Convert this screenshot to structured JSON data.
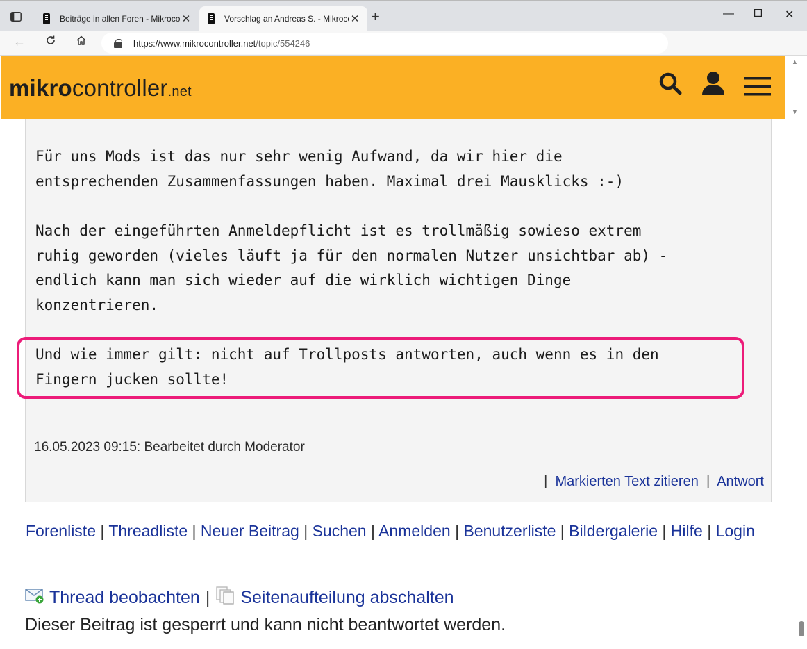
{
  "browser": {
    "tabs": [
      {
        "title": "Beiträge in allen Foren - Mikrocontroller.net"
      },
      {
        "title": "Vorschlag an Andreas S. - Mikrocontroller.net"
      }
    ],
    "url_host": "https://www.mikrocontroller.net",
    "url_path": "/topic/554246"
  },
  "site": {
    "logo_bold": "mikro",
    "logo_regular": "controller",
    "logo_tld": ".net"
  },
  "post": {
    "paragraphs": [
      "Für uns Mods ist das nur sehr wenig Aufwand, da wir hier die\nentsprechenden Zusammenfassungen haben. Maximal drei Mausklicks :-)",
      "Nach der eingeführten Anmeldepflicht ist es trollmäßig sowieso extrem\nruhig geworden (vieles läuft ja für den normalen Nutzer unsichtbar ab) -\nendlich kann man sich wieder auf die wirklich wichtigen Dinge\nkonzentrieren.",
      "Und wie immer gilt: nicht auf Trollposts antworten, auch wenn es in den\nFingern jucken sollte!"
    ],
    "edited_note": "16.05.2023 09:15: Bearbeitet durch Moderator",
    "actions": {
      "separator": "|",
      "quote": "Markierten Text zitieren",
      "reply": "Antwort"
    }
  },
  "footer_nav": {
    "links": [
      "Forenliste",
      "Threadliste",
      "Neuer Beitrag",
      "Suchen",
      "Anmelden",
      "Benutzerliste",
      "Bildergalerie",
      "Hilfe",
      "Login"
    ],
    "separator": "|"
  },
  "thread_actions": {
    "watch": "Thread beobachten",
    "paging": "Seitenaufteilung abschalten",
    "separator": "|"
  },
  "locked_notice": "Dieser Beitrag ist gesperrt und kann nicht beantwortet werden.",
  "colors": {
    "header_bg": "#fbb024",
    "link": "#1a3399",
    "highlight_border": "#ec1c79"
  }
}
